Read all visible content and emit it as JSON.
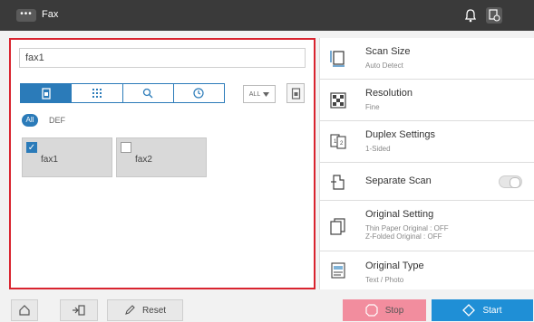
{
  "header": {
    "menu_icon": "more-dots-icon",
    "title": "Fax",
    "icons": [
      "bell-icon",
      "job-status-icon"
    ]
  },
  "destination": {
    "address_value": "fax1",
    "tabs": [
      {
        "icon": "address-book-icon",
        "selected": true
      },
      {
        "icon": "keypad-icon",
        "selected": false
      },
      {
        "icon": "search-icon",
        "selected": false
      },
      {
        "icon": "history-clock-icon",
        "selected": false
      }
    ],
    "index_select_value": "ALL",
    "filters": {
      "all_label": "All",
      "def_label": "DEF"
    },
    "entries": [
      {
        "label": "fax1",
        "checked": true
      },
      {
        "label": "fax2",
        "checked": false
      }
    ]
  },
  "settings": {
    "scan_size": {
      "title": "Scan Size",
      "value": "Auto Detect"
    },
    "resolution": {
      "title": "Resolution",
      "value": "Fine"
    },
    "duplex": {
      "title": "Duplex Settings",
      "value": "1-Sided"
    },
    "separate_scan": {
      "title": "Separate Scan",
      "on": false
    },
    "original_setting": {
      "title": "Original Setting",
      "line1": "Thin Paper Original : OFF",
      "line2": "Z-Folded Original : OFF"
    },
    "original_type": {
      "title": "Original Type",
      "value": "Text / Photo"
    }
  },
  "footer": {
    "reset_label": "Reset",
    "stop_label": "Stop",
    "start_label": "Start"
  },
  "colors": {
    "accent_blue": "#2b7bb9",
    "highlight_red": "#d9242f",
    "stop_pink": "#f28d9e",
    "start_blue": "#1f8fd6"
  }
}
